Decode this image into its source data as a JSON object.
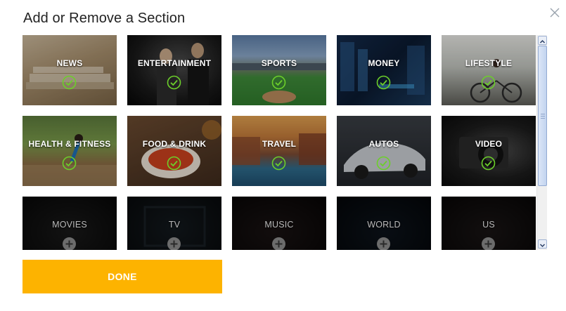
{
  "dialog": {
    "title": "Add or Remove a Section",
    "close_icon": "close-icon"
  },
  "accent_color": "#fdb300",
  "check_color": "#6ccf2a",
  "sections": [
    {
      "label": "NEWS",
      "selected": true
    },
    {
      "label": "ENTERTAINMENT",
      "selected": true
    },
    {
      "label": "SPORTS",
      "selected": true
    },
    {
      "label": "MONEY",
      "selected": true
    },
    {
      "label": "LIFESTYLE",
      "selected": true
    },
    {
      "label": "HEALTH & FITNESS",
      "selected": true
    },
    {
      "label": "FOOD & DRINK",
      "selected": true
    },
    {
      "label": "TRAVEL",
      "selected": true
    },
    {
      "label": "AUTOS",
      "selected": true
    },
    {
      "label": "VIDEO",
      "selected": true
    },
    {
      "label": "MOVIES",
      "selected": false
    },
    {
      "label": "TV",
      "selected": false
    },
    {
      "label": "MUSIC",
      "selected": false
    },
    {
      "label": "WORLD",
      "selected": false
    },
    {
      "label": "US",
      "selected": false
    }
  ],
  "done_button": {
    "label": "DONE"
  }
}
